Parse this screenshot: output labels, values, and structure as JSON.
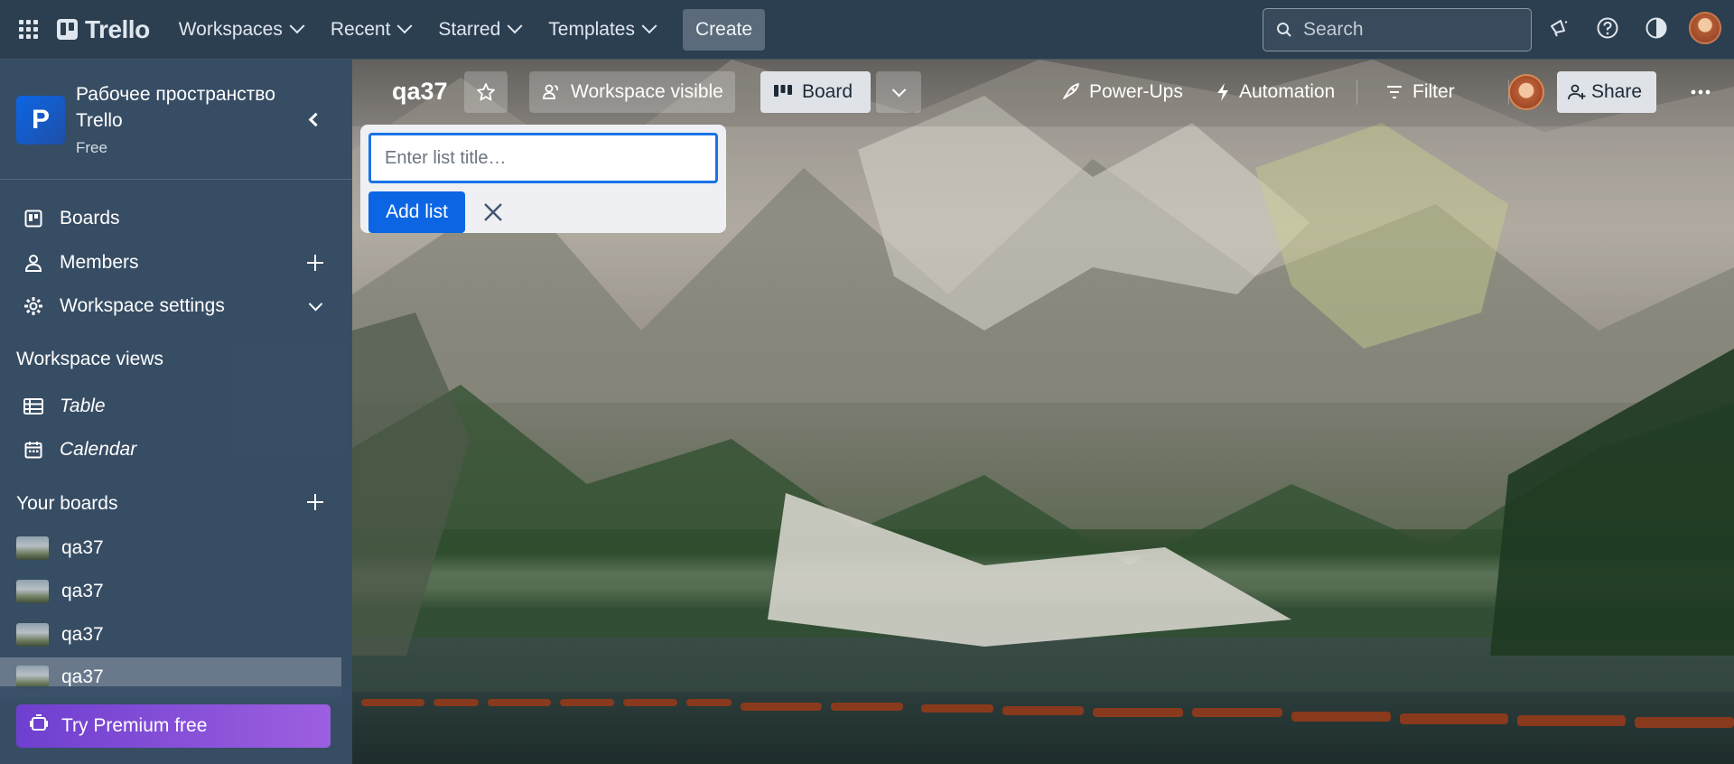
{
  "topnav": {
    "logo": "Trello",
    "menu": [
      {
        "label": "Workspaces"
      },
      {
        "label": "Recent"
      },
      {
        "label": "Starred"
      },
      {
        "label": "Templates"
      }
    ],
    "create_label": "Create",
    "search_placeholder": "Search",
    "icons": [
      "apps-grid-icon",
      "megaphone-icon",
      "help-icon",
      "theme-contrast-icon",
      "user-avatar"
    ]
  },
  "sidebar": {
    "workspace_initial": "P",
    "workspace_name": "Рабочее пространство Trello",
    "workspace_plan": "Free",
    "items": [
      {
        "label": "Boards",
        "icon": "board-icon"
      },
      {
        "label": "Members",
        "icon": "person-icon"
      },
      {
        "label": "Workspace settings",
        "icon": "gear-icon"
      }
    ],
    "views_heading": "Workspace views",
    "views": [
      {
        "label": "Table",
        "icon": "table-icon"
      },
      {
        "label": "Calendar",
        "icon": "calendar-icon"
      }
    ],
    "boards_heading": "Your boards",
    "boards": [
      {
        "label": "qa37"
      },
      {
        "label": "qa37"
      },
      {
        "label": "qa37"
      },
      {
        "label": "qa37"
      }
    ],
    "premium_label": "Try Premium free"
  },
  "board": {
    "title": "qa37",
    "visibility_label": "Workspace visible",
    "view_label": "Board",
    "powerups_label": "Power-Ups",
    "automation_label": "Automation",
    "filter_label": "Filter",
    "share_label": "Share"
  },
  "add_list": {
    "placeholder": "Enter list title…",
    "button_label": "Add list"
  },
  "colors": {
    "nav_bg": "#2c3f51",
    "sidebar_bg": "#384f66",
    "accent_blue": "#0c66e4",
    "premium_purple": "#7f4fd8"
  }
}
